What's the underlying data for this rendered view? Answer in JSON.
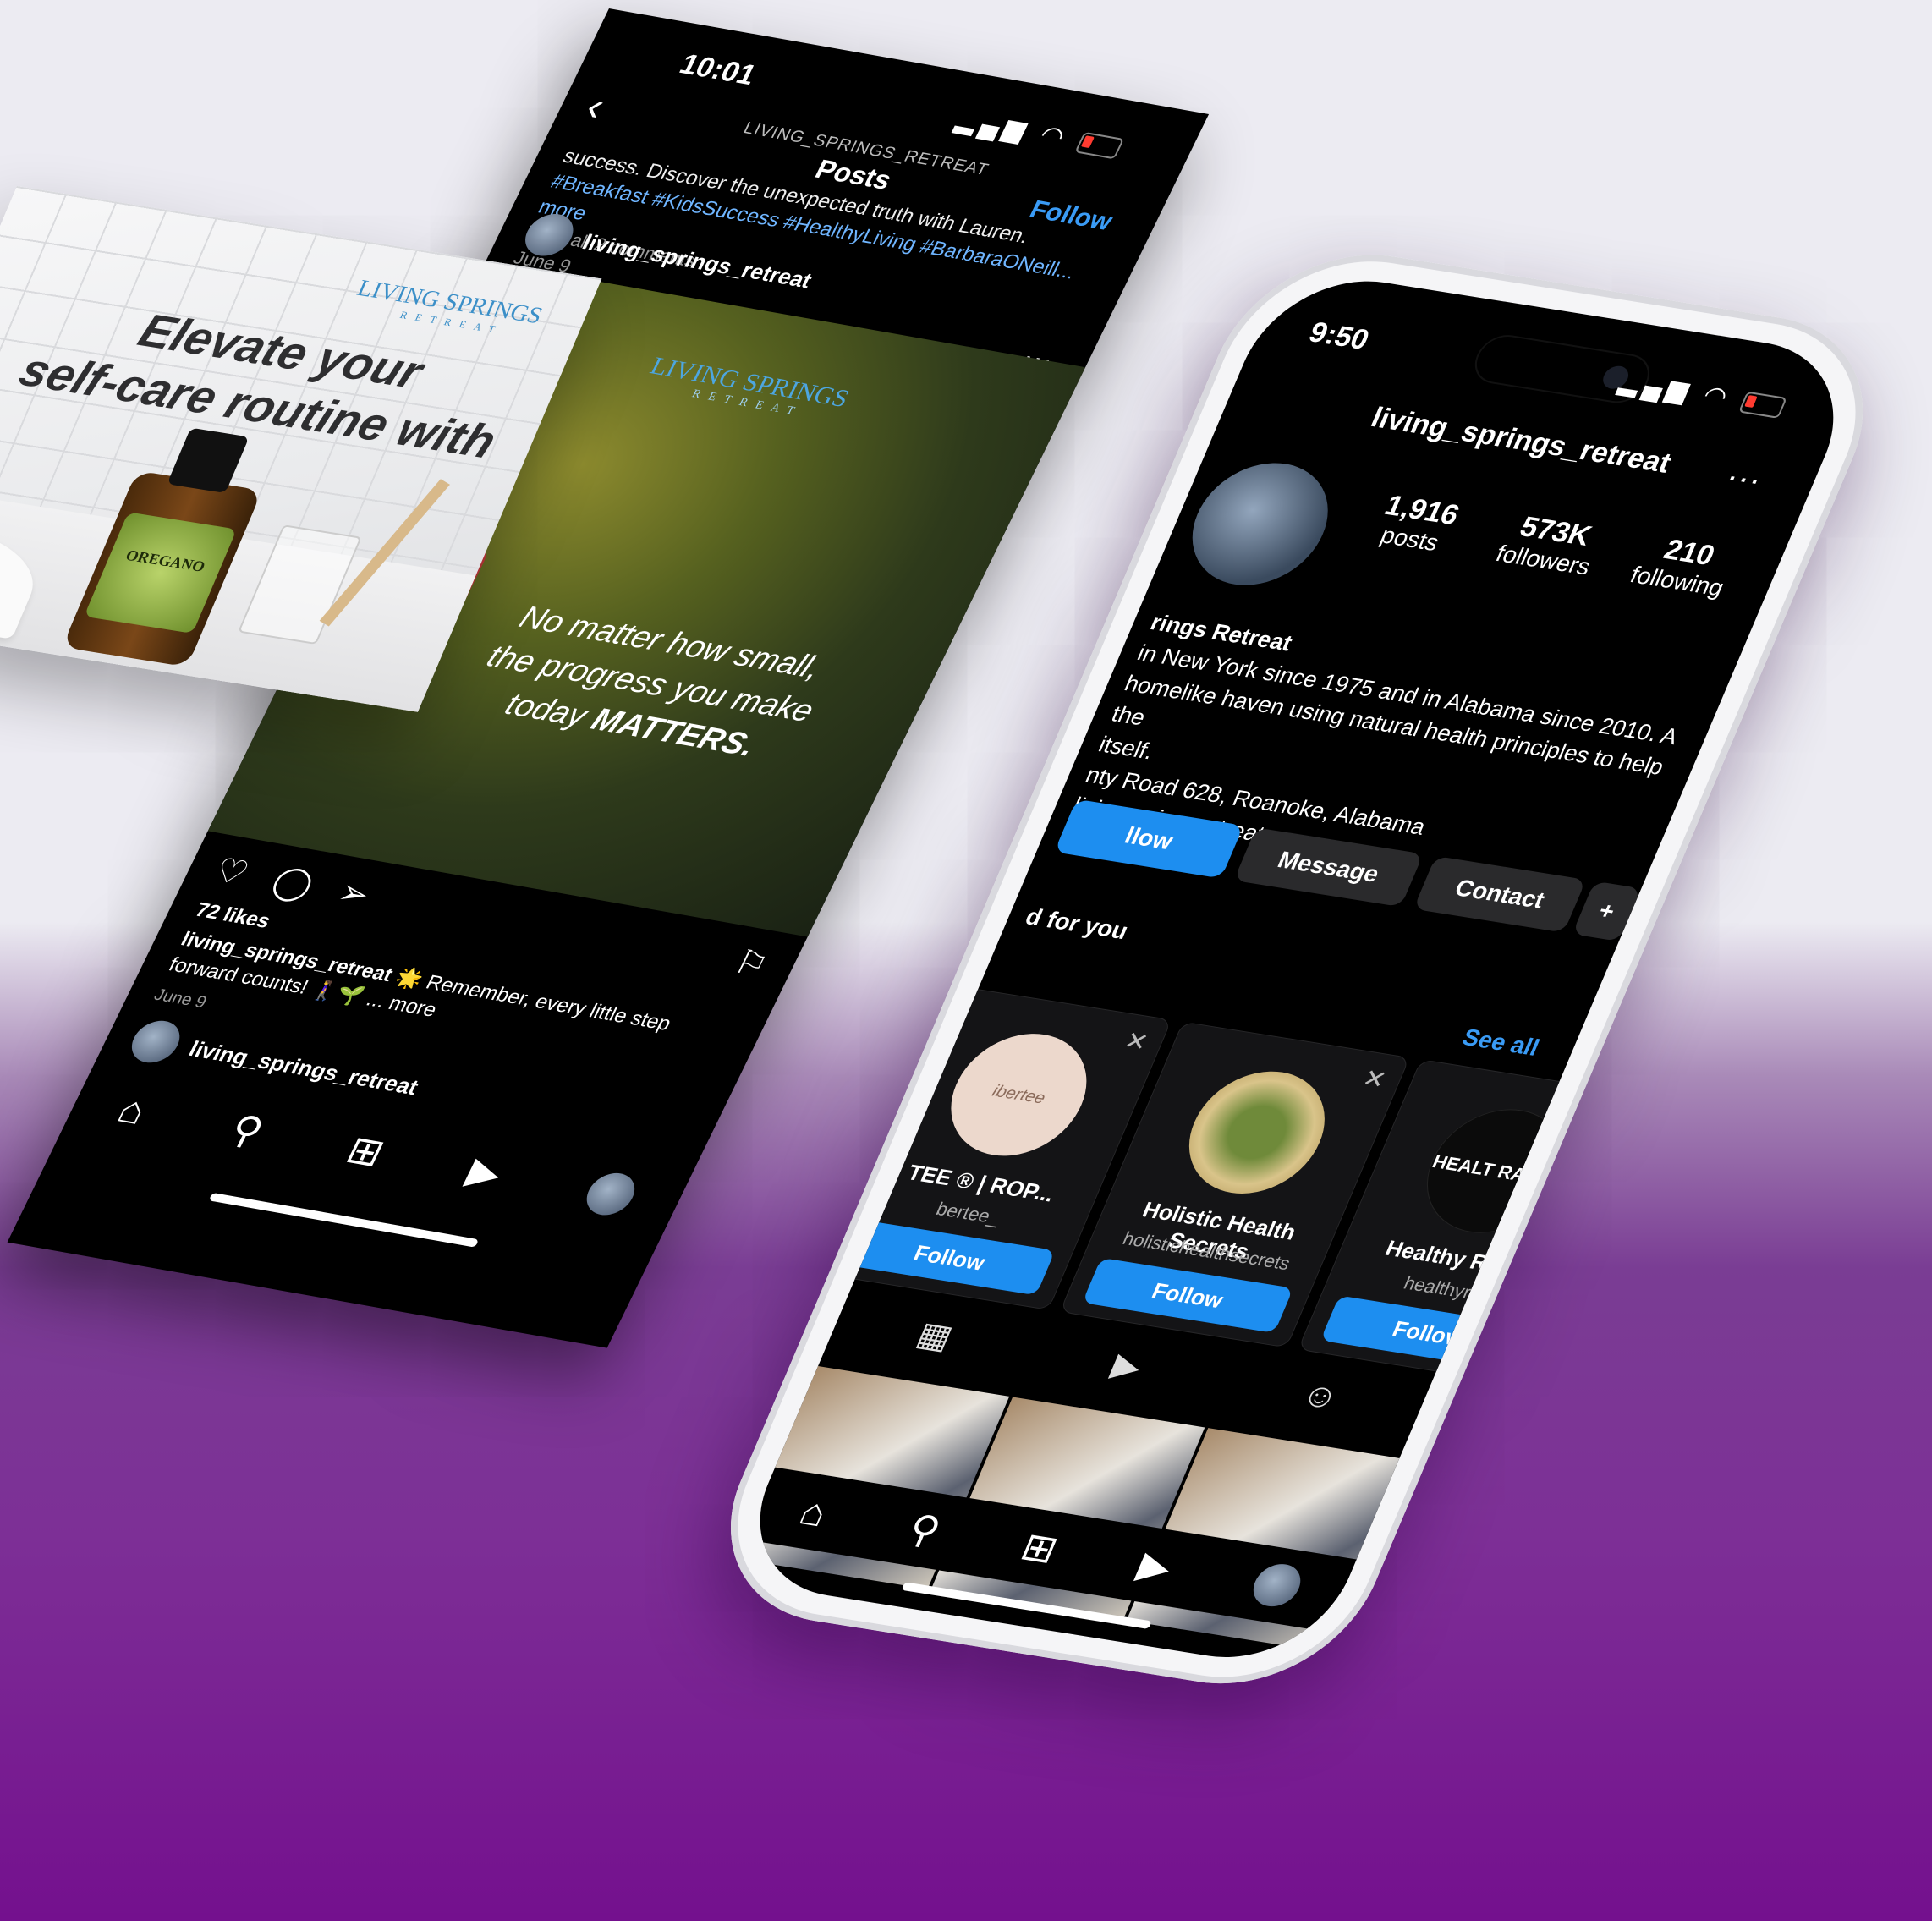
{
  "profile_phone": {
    "time": "9:50",
    "username": "living_springs_retreat",
    "stats": {
      "posts": {
        "value": "1,916",
        "label": "posts"
      },
      "followers": {
        "value": "573K",
        "label": "followers"
      },
      "following": {
        "value": "210",
        "label": "following"
      }
    },
    "bio": {
      "name": "rings Retreat",
      "line1": "in New York since 1975 and in Alabama since 2010. A",
      "line2": "homelike haven using natural health principles to help the",
      "line3": "itself.",
      "line4": "nty Road 628, Roanoke, Alabama",
      "link": "livingspringsretreat.com"
    },
    "buttons": {
      "follow": "llow",
      "message": "Message",
      "contact": "Contact"
    },
    "suggested_label": "d for you",
    "see_all": "See all",
    "suggestions": [
      {
        "name": "TEE ® | ROP...",
        "handle": "bertee_",
        "follow": "Follow",
        "pic_text": "ibertee"
      },
      {
        "name": "Holistic Health Secrets",
        "handle": "holistichealthsecrets",
        "follow": "Follow",
        "pic_text": ""
      },
      {
        "name": "Healthy Railw",
        "handle": "healthyrai",
        "follow": "Follov",
        "pic_text": "HEALT RAILW"
      }
    ]
  },
  "feed_phone": {
    "time": "10:01",
    "account_label": "LIVING_SPRINGS_RETREAT",
    "title": "Posts",
    "follow": "Follow",
    "caption_top": "success. Discover the unexpected truth with Lauren.",
    "hashtags": "#Breakfast #KidsSuccess #HealthyLiving #BarbaraONeill... more",
    "view_comments": "View all 2 comments",
    "date_top": "June 9",
    "post_user": "living_springs_retreat",
    "post_image": {
      "logo": "LIVING SPRINGS",
      "logo_sub": "RETREAT",
      "quote_line1": "No matter how small,",
      "quote_line2": "the progress you make",
      "quote_line3": "today",
      "quote_emphasis": "MATTERS."
    },
    "likes": "72 likes",
    "caption_user": "living_springs_retreat",
    "caption": "🌟 Remember, every little step forward counts! 🚶‍♀️🌱 ... more",
    "date": "June 9",
    "next_user": "living_springs_retreat"
  },
  "selfcare_post": {
    "logo": "LIVING SPRINGS",
    "logo_sub": "RETREAT",
    "headline_line1": "Elevate your",
    "headline_line2": "self-care routine with",
    "bottle_label": "OREGANO"
  },
  "colors": {
    "accent_blue": "#1d8ef0",
    "link_blue": "#3a9bf5",
    "background_purple": "#7d2f96",
    "background_light": "#ecebf2"
  },
  "icons": {
    "home": "home-icon",
    "search": "search-icon",
    "create": "create-icon",
    "reels": "reels-icon",
    "profile": "profile-avatar"
  }
}
